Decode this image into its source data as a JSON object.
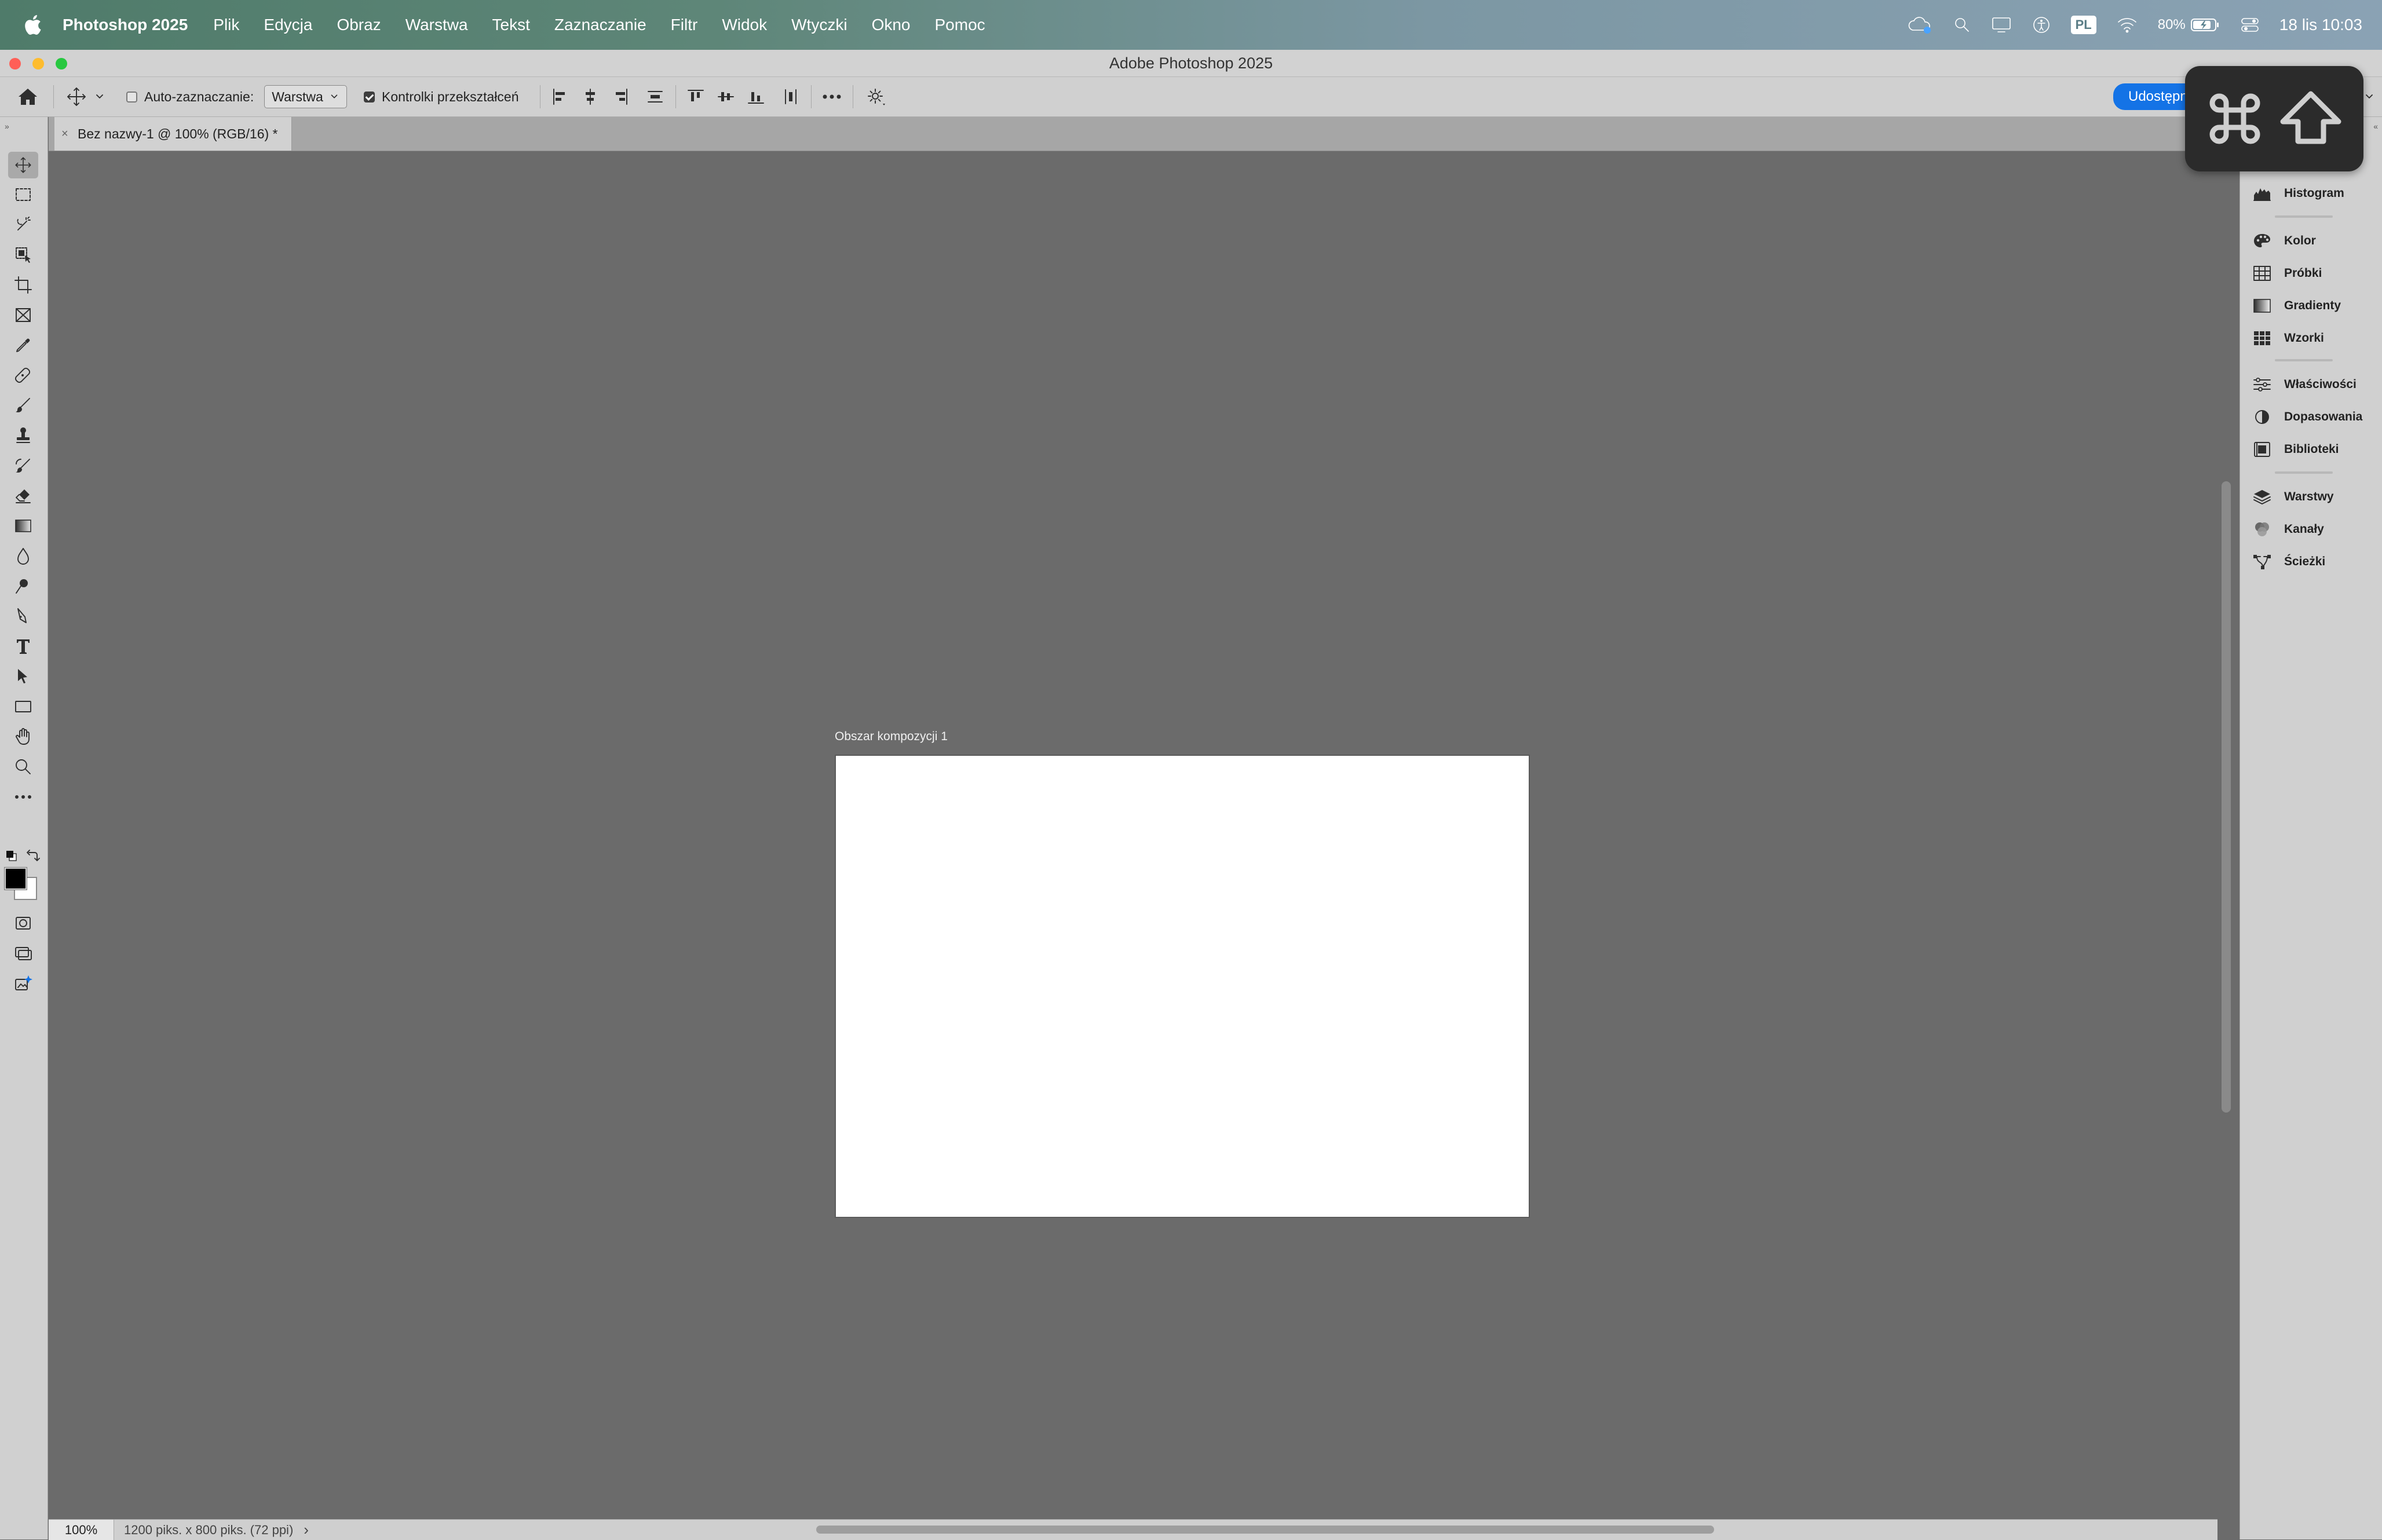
{
  "menubar": {
    "app_name": "Photoshop 2025",
    "items": [
      "Plik",
      "Edycja",
      "Obraz",
      "Warstwa",
      "Tekst",
      "Zaznaczanie",
      "Filtr",
      "Widok",
      "Wtyczki",
      "Okno",
      "Pomoc"
    ],
    "input_source": "PL",
    "battery": "80%",
    "datetime": "18 lis  10:03"
  },
  "window": {
    "title": "Adobe Photoshop 2025"
  },
  "options_bar": {
    "auto_select_label": "Auto-zaznaczanie:",
    "auto_select_checked": false,
    "auto_select_target": "Warstwa",
    "transform_controls_label": "Kontrolki przekształceń",
    "transform_controls_checked": true,
    "share_label": "Udostępnij"
  },
  "document_tab": {
    "title": "Bez nazwy-1 @ 100% (RGB/16) *"
  },
  "artboard": {
    "label": "Obszar kompozycji 1"
  },
  "status_bar": {
    "zoom": "100%",
    "doc_info": "1200 piks. x 800 piks. (72 ppi)",
    "arrow": "›"
  },
  "panels": [
    {
      "label": "Histogram",
      "icon": "histogram-icon"
    },
    {
      "label": "Kolor",
      "icon": "color-palette-icon"
    },
    {
      "label": "Próbki",
      "icon": "swatches-icon"
    },
    {
      "label": "Gradienty",
      "icon": "gradients-icon"
    },
    {
      "label": "Wzorki",
      "icon": "patterns-icon"
    },
    {
      "label": "Właściwości",
      "icon": "properties-icon"
    },
    {
      "label": "Dopasowania",
      "icon": "adjustments-icon"
    },
    {
      "label": "Biblioteki",
      "icon": "libraries-icon"
    },
    {
      "label": "Warstwy",
      "icon": "layers-icon"
    },
    {
      "label": "Kanały",
      "icon": "channels-icon"
    },
    {
      "label": "Ścieżki",
      "icon": "paths-icon"
    }
  ],
  "keycast": {
    "keys": [
      "command-icon",
      "shift-icon"
    ]
  },
  "colors": {
    "canvas_bg": "#6b6b6b",
    "ui_panel": "#d0d0d0",
    "share_button": "#1473e6",
    "foreground_swatch": "#000000",
    "background_swatch": "#ffffff"
  }
}
